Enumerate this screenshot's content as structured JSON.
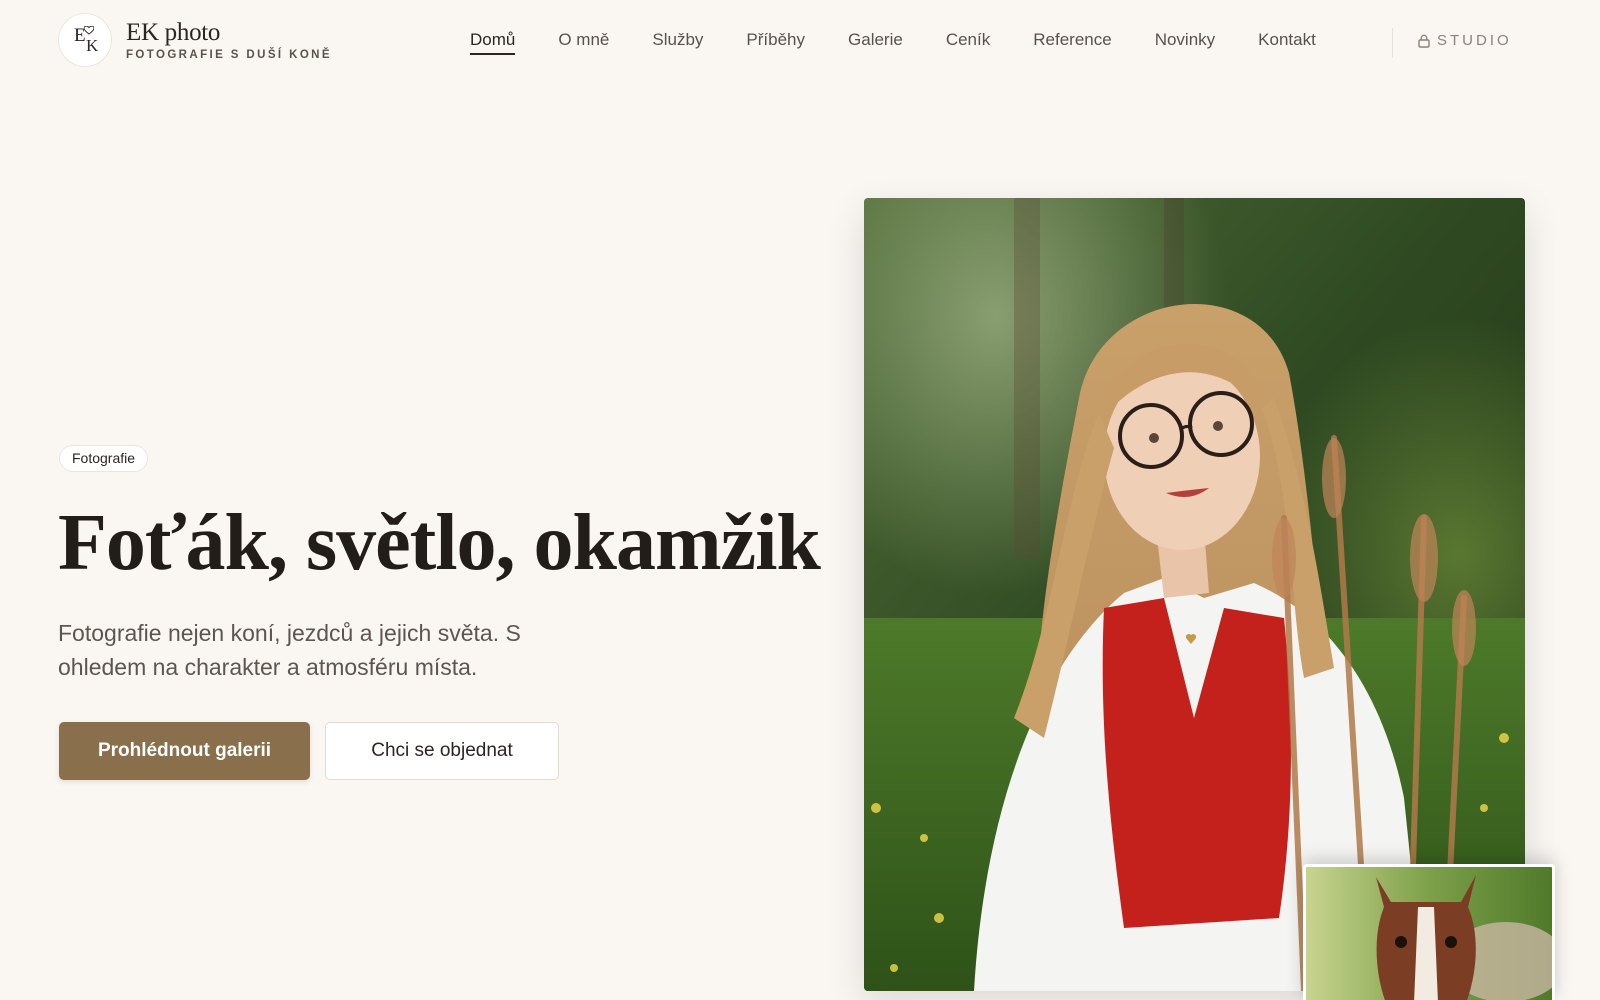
{
  "brand": {
    "name": "EK photo",
    "tagline": "FOTOGRAFIE S DUŠÍ KONĚ",
    "logo_letters": "EK"
  },
  "nav": {
    "items": [
      {
        "label": "Domů",
        "active": true
      },
      {
        "label": "O mně",
        "active": false
      },
      {
        "label": "Služby",
        "active": false
      },
      {
        "label": "Příběhy",
        "active": false
      },
      {
        "label": "Galerie",
        "active": false
      },
      {
        "label": "Ceník",
        "active": false
      },
      {
        "label": "Reference",
        "active": false
      },
      {
        "label": "Novinky",
        "active": false
      },
      {
        "label": "Kontakt",
        "active": false
      }
    ],
    "studio_label": "STUDIO",
    "studio_icon": "lock-icon"
  },
  "hero": {
    "badge": "Fotografie",
    "title": "Foťák, světlo, okamžik",
    "subtitle_line1": "Fotografie nejen koní, jezdců a jejich světa. S",
    "subtitle_line2": "ohledem na charakter a atmosféru místa.",
    "primary_button": "Prohlédnout galerii",
    "secondary_button": "Chci se objednat"
  },
  "images": {
    "main": "portrait-woman-in-meadow",
    "thumbnail": "foal-head-closeup"
  },
  "colors": {
    "background": "#faf7f3",
    "accent": "#8a6f4d",
    "text": "#2b2622"
  }
}
